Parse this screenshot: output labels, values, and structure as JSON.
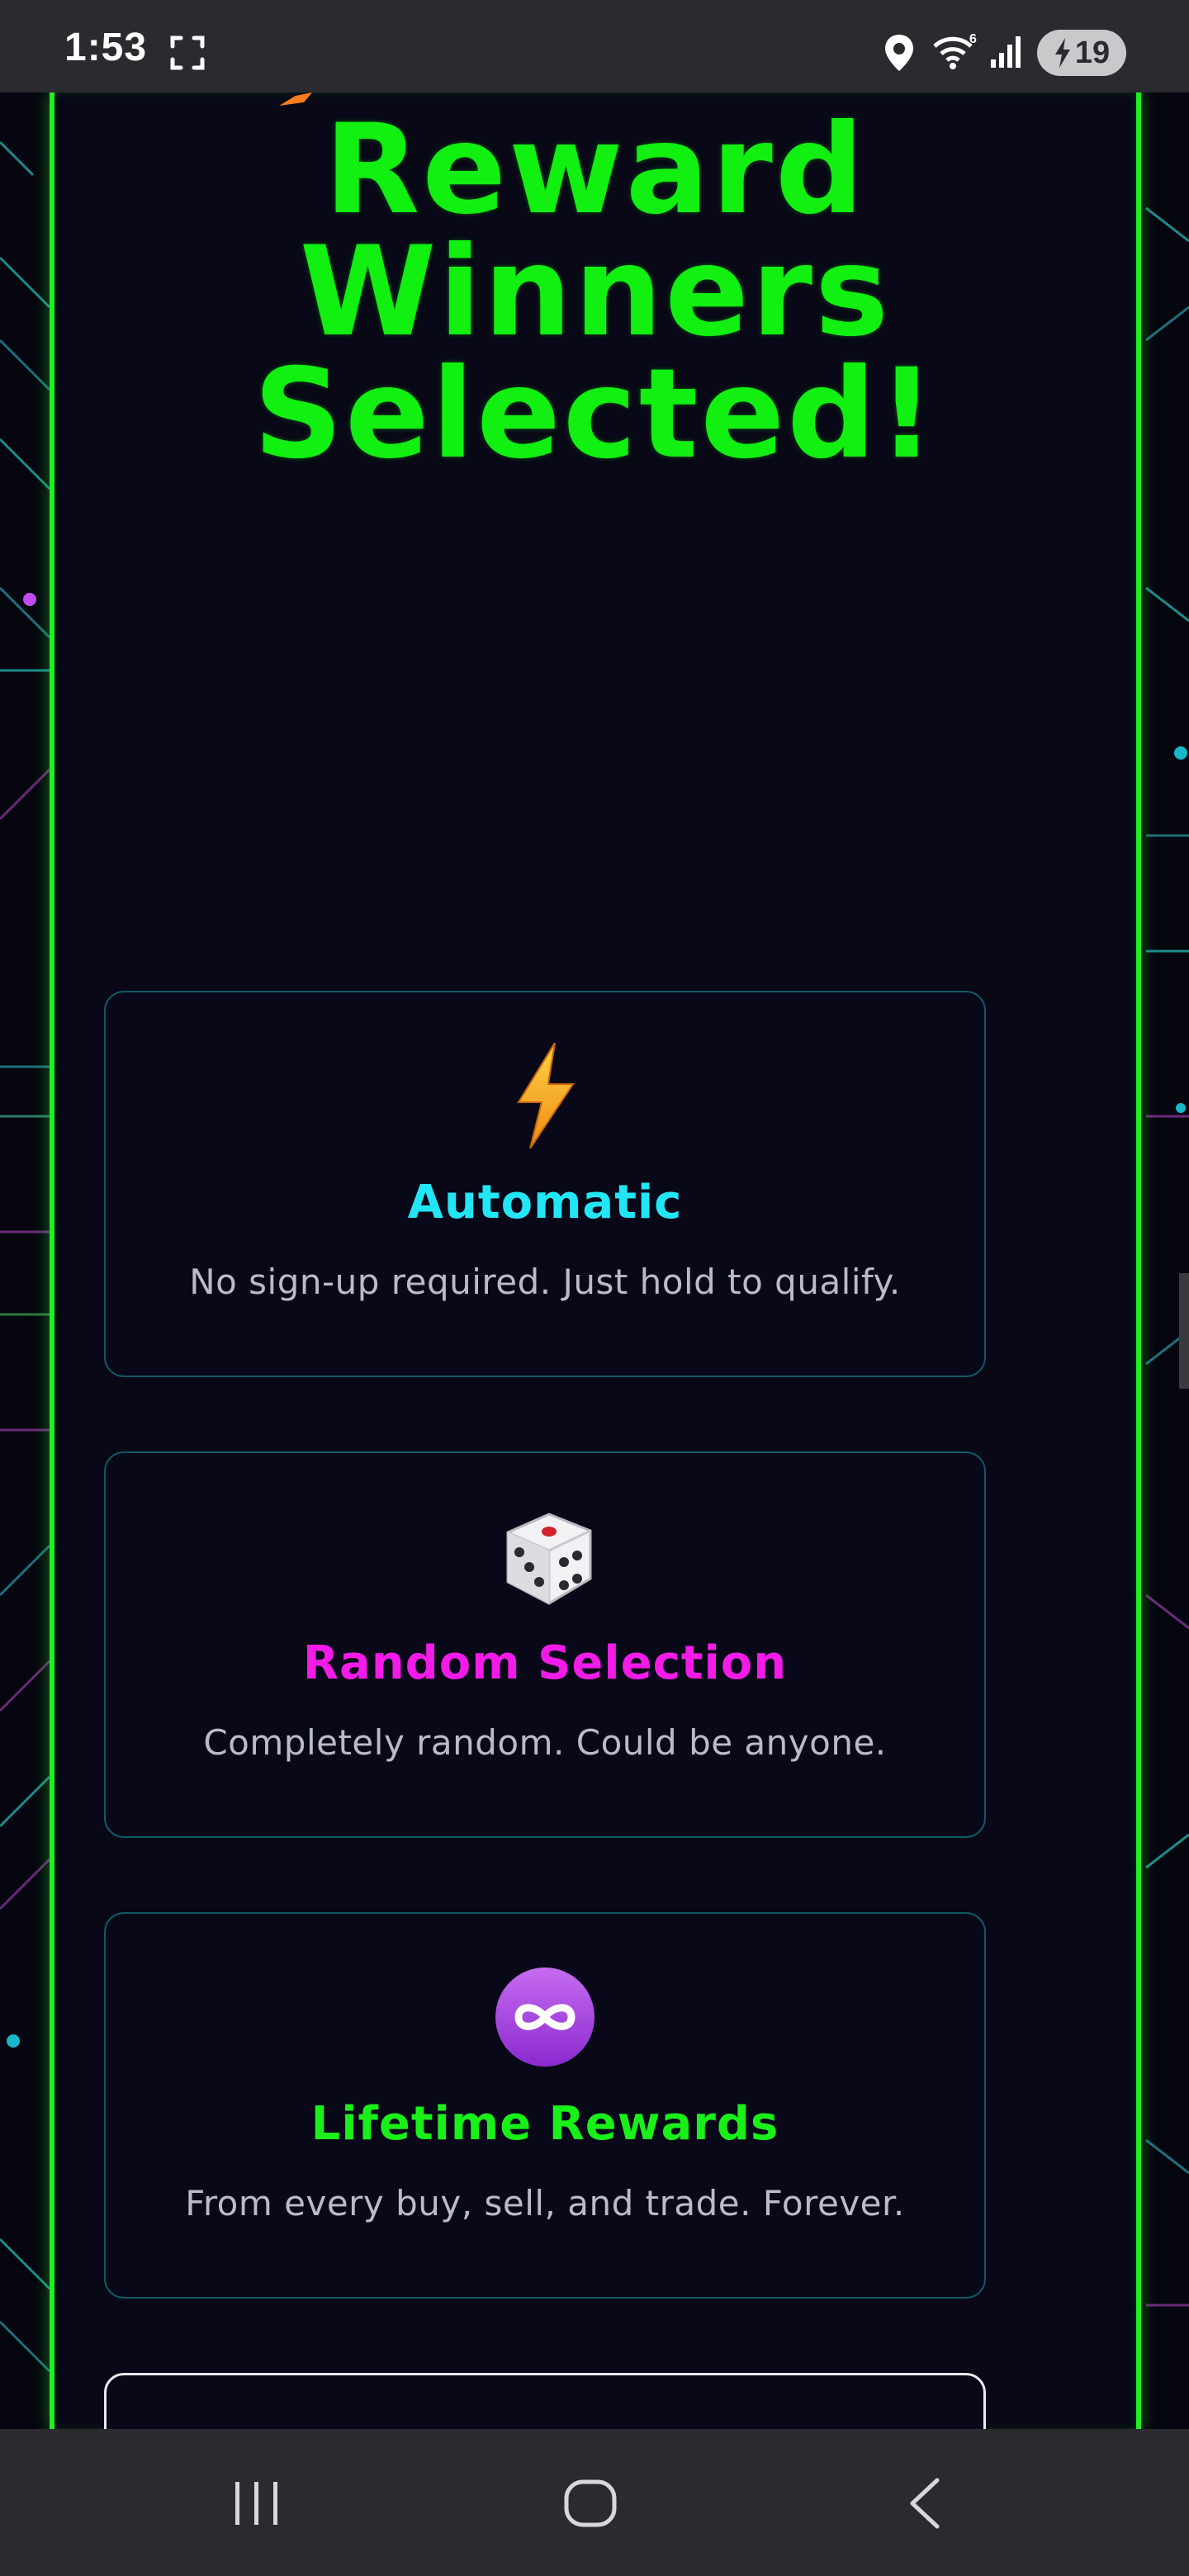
{
  "status_bar": {
    "time": "1:53",
    "battery_level": "19",
    "icons": [
      "screenshot-icon",
      "location-icon",
      "wifi-icon",
      "signal-icon",
      "battery-charging-icon"
    ]
  },
  "hero": {
    "title_lines": [
      "Reward",
      "Winners",
      "Selected!"
    ],
    "title_color": "#11f011"
  },
  "features": [
    {
      "icon": "lightning-icon",
      "title": "Automatic",
      "title_color": "#23e6f5",
      "description": "No sign-up required. Just hold to qualify."
    },
    {
      "icon": "dice-icon",
      "title": "Random Selection",
      "title_color": "#f21be8",
      "description": "Completely random. Could be anyone."
    },
    {
      "icon": "infinity-icon",
      "title": "Lifetime Rewards",
      "title_color": "#19f019",
      "description": "From every buy, sell, and trade. Forever."
    }
  ],
  "navigation": {
    "buttons": [
      "recent-apps-icon",
      "home-icon",
      "back-icon"
    ]
  },
  "colors": {
    "background": "#05060f",
    "panel_border": "#22ee22",
    "card_border": "#0e5a66"
  }
}
